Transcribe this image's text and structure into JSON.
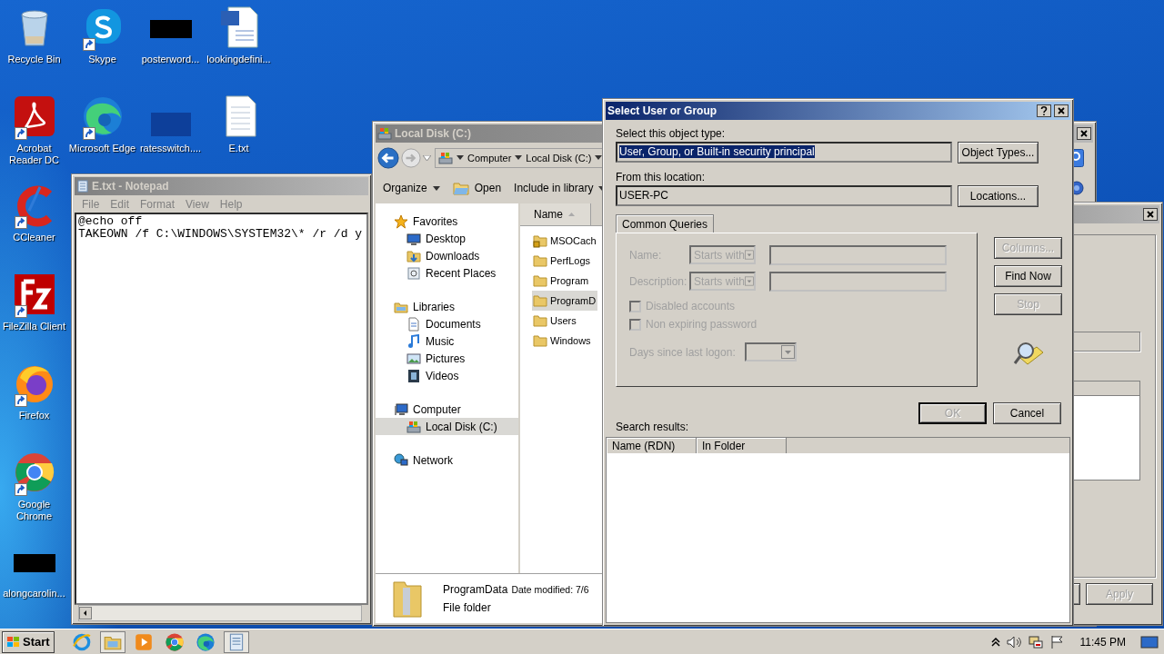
{
  "desktop": {
    "icons": [
      {
        "label": "Recycle Bin",
        "kind": "recycle",
        "shortcut": false
      },
      {
        "label": "Skype",
        "kind": "skype",
        "shortcut": true
      },
      {
        "label": "posterword...",
        "kind": "blackout",
        "shortcut": false
      },
      {
        "label": "lookingdefini...",
        "kind": "word",
        "shortcut": false
      },
      {
        "label": "Acrobat Reader DC",
        "kind": "acrobat",
        "shortcut": true
      },
      {
        "label": "Microsoft Edge",
        "kind": "edge",
        "shortcut": true
      },
      {
        "label": "ratesswitch....",
        "kind": "bluebox",
        "shortcut": false
      },
      {
        "label": "E.txt",
        "kind": "text",
        "shortcut": false
      },
      {
        "label": "CCleaner",
        "kind": "ccleaner",
        "shortcut": true
      },
      {
        "label": "FileZilla Client",
        "kind": "filezilla",
        "shortcut": true
      },
      {
        "label": "Firefox",
        "kind": "firefox",
        "shortcut": true
      },
      {
        "label": "Google Chrome",
        "kind": "chrome",
        "shortcut": true
      },
      {
        "label": "alongcarolin...",
        "kind": "blackout",
        "shortcut": false
      }
    ]
  },
  "notepad": {
    "title": "E.txt - Notepad",
    "active": false,
    "menu": [
      "File",
      "Edit",
      "Format",
      "View",
      "Help"
    ],
    "lines": [
      "@echo off",
      "TAKEOWN /f C:\\WINDOWS\\SYSTEM32\\* /r /d y"
    ]
  },
  "explorer": {
    "title": "Local Disk (C:)",
    "active": false,
    "breadcrumbs": [
      "Computer",
      "Local Disk (C:)"
    ],
    "toolbar": [
      {
        "label": "Organize",
        "kind": "menu"
      },
      {
        "label": "Open",
        "kind": "open"
      },
      {
        "label": "Include in library",
        "kind": "menu"
      }
    ],
    "nav": [
      {
        "label": "Favorites",
        "kind": "star",
        "selected": false,
        "children": [
          {
            "label": "Desktop",
            "kind": "desktop",
            "selected": false
          },
          {
            "label": "Downloads",
            "kind": "downloads",
            "selected": false
          },
          {
            "label": "Recent Places",
            "kind": "recent",
            "selected": false
          }
        ]
      },
      {
        "label": "Libraries",
        "kind": "libraries",
        "selected": false,
        "children": [
          {
            "label": "Documents",
            "kind": "documents",
            "selected": false
          },
          {
            "label": "Music",
            "kind": "music",
            "selected": false
          },
          {
            "label": "Pictures",
            "kind": "pictures",
            "selected": false
          },
          {
            "label": "Videos",
            "kind": "videos",
            "selected": false
          }
        ]
      },
      {
        "label": "Computer",
        "kind": "computer",
        "selected": false,
        "children": [
          {
            "label": "Local Disk (C:)",
            "kind": "drive",
            "selected": true
          }
        ]
      },
      {
        "label": "Network",
        "kind": "network",
        "selected": false
      }
    ],
    "column": "Name",
    "files": [
      {
        "name": "MSOCach",
        "kind": "locked",
        "selected": false
      },
      {
        "name": "PerfLogs",
        "kind": "folder",
        "selected": false
      },
      {
        "name": "Program",
        "kind": "folder",
        "selected": false
      },
      {
        "name": "ProgramD",
        "kind": "folder",
        "selected": true
      },
      {
        "name": "Users",
        "kind": "folder",
        "selected": false
      },
      {
        "name": "Windows",
        "kind": "folder",
        "selected": false
      }
    ],
    "details": {
      "name": "ProgramData",
      "modified": "Date modified: 7/6",
      "type": "File folder"
    }
  },
  "properties": {
    "active": false,
    "buttons": [
      {
        "label": "Apply",
        "disabled": true
      }
    ]
  },
  "dialog": {
    "title": "Select User or Group",
    "active": true,
    "object_type_label": "Select this object type:",
    "object_type": "User, Group, or Built-in security principal",
    "object_types_button": "Object Types...",
    "location_label": "From this location:",
    "location": "USER-PC",
    "locations_button": "Locations...",
    "tab": "Common Queries",
    "queries": [
      {
        "label": "Name:",
        "mode": "Starts with",
        "disabled": true
      },
      {
        "label": "Description:",
        "mode": "Starts with",
        "disabled": true
      }
    ],
    "checkboxes": [
      {
        "label": "Disabled accounts",
        "checked": false,
        "disabled": true
      },
      {
        "label": "Non expiring password",
        "checked": false,
        "disabled": true
      }
    ],
    "days_label": "Days since last logon:",
    "side_buttons": [
      {
        "label": "Columns...",
        "disabled": true
      },
      {
        "label": "Find Now",
        "disabled": false
      },
      {
        "label": "Stop",
        "disabled": true
      }
    ],
    "ok": {
      "label": "OK",
      "disabled": true
    },
    "cancel": {
      "label": "Cancel",
      "disabled": false
    },
    "results_label": "Search results:",
    "columns": [
      "Name (RDN)",
      "In Folder"
    ]
  },
  "taskbar": {
    "start": "Start",
    "apps": [
      {
        "kind": "ie",
        "active": false
      },
      {
        "kind": "explorer",
        "active": true
      },
      {
        "kind": "media",
        "active": false
      },
      {
        "kind": "chrome",
        "active": false
      },
      {
        "kind": "edge",
        "active": false
      },
      {
        "kind": "notepad",
        "active": true
      }
    ],
    "clock": "11:45 PM"
  }
}
